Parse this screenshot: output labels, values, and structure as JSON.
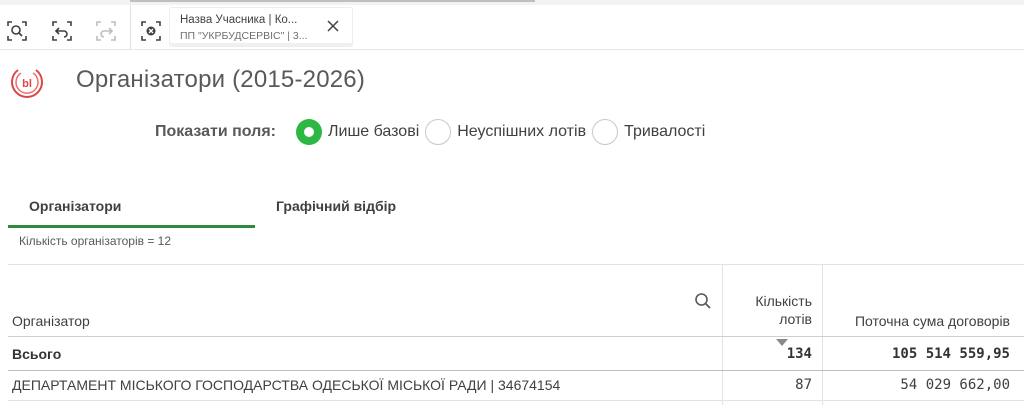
{
  "selections": {
    "chip": {
      "field": "Назва Учасника | Ко...",
      "value": "ПП \"УКРБУДСЕРВІС\" | 3..."
    },
    "tools": [
      "search-in-selections-icon",
      "step-back-icon",
      "step-forward-icon",
      "clear-all-selections-icon"
    ],
    "accent": "#2db846"
  },
  "sheet": {
    "title": "Організатори (2015-2026)"
  },
  "fields": {
    "label": "Показати поля:",
    "options": [
      {
        "label": "Лише базові",
        "checked": true
      },
      {
        "label": "Неуспішних лотів",
        "checked": false
      },
      {
        "label": "Тривалості",
        "checked": false
      }
    ]
  },
  "tabs": [
    {
      "label": "Організатори",
      "active": true
    },
    {
      "label": "Графічний відбір",
      "active": false
    }
  ],
  "count_text": "Кількість організаторів = 12",
  "table": {
    "columns": [
      {
        "label": "Організатор"
      },
      {
        "label": "Кількість лотів"
      },
      {
        "label": "Поточна сума договорів"
      }
    ],
    "total": {
      "label": "Всього",
      "lots": "134",
      "sum": "105 514 559,95"
    },
    "rows": [
      {
        "name": "ДЕПАРТАМЕНТ МІСЬКОГО ГОСПОДАРСТВА ОДЕСЬКОЇ МІСЬКОЇ РАДИ | 34674154",
        "lots": "87",
        "sum": "54 029 662,00"
      }
    ]
  }
}
